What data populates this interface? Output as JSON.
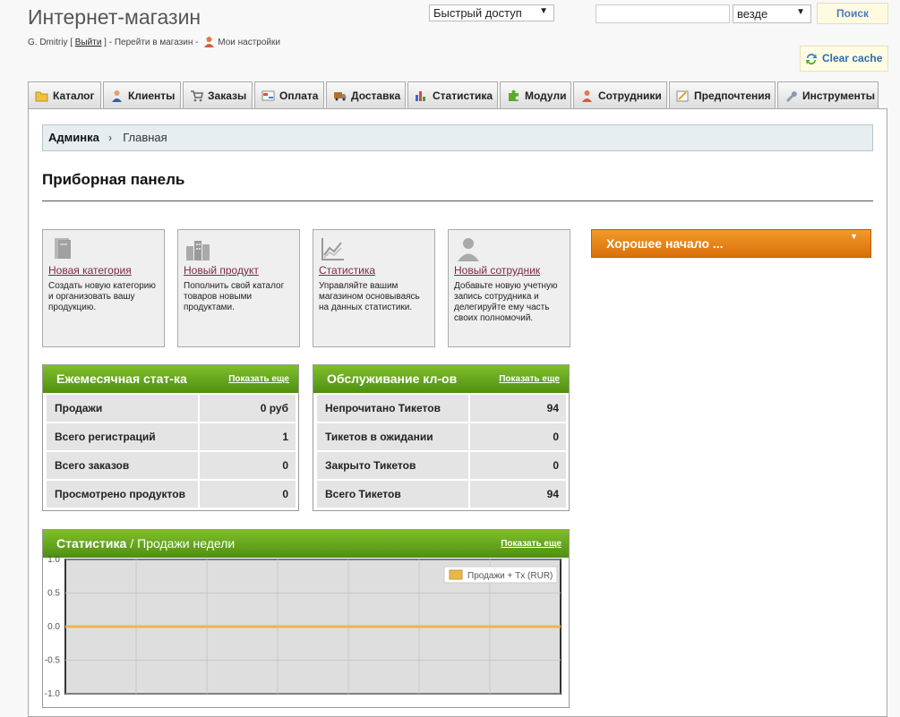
{
  "header": {
    "shop_title": "Интернет-магазин",
    "user_name": "G. Dmitriy",
    "logout_label": "Выйти",
    "goto_shop": "Перейти в магазин",
    "my_settings": "Мои настройки",
    "quick_access": "Быстрый доступ",
    "search_placeholder": "",
    "search_scope": "везде",
    "search_button": "Поиск",
    "clear_cache": "Clear cache"
  },
  "tabs": [
    {
      "label": "Каталог",
      "icon": "folder-icon"
    },
    {
      "label": "Клиенты",
      "icon": "person-icon"
    },
    {
      "label": "Заказы",
      "icon": "cart-icon"
    },
    {
      "label": "Оплата",
      "icon": "payment-icon"
    },
    {
      "label": "Доставка",
      "icon": "truck-icon"
    },
    {
      "label": "Статистика",
      "icon": "bar-chart-icon"
    },
    {
      "label": "Модули",
      "icon": "puzzle-icon"
    },
    {
      "label": "Сотрудники",
      "icon": "employee-icon"
    },
    {
      "label": "Предпочтения",
      "icon": "preferences-icon"
    },
    {
      "label": "Инструменты",
      "icon": "wrench-icon"
    }
  ],
  "breadcrumb": {
    "root": "Админка",
    "current": "Главная"
  },
  "page_title": "Приборная панель",
  "quick_cards": [
    {
      "title": "Новая категория",
      "desc": "Создать новую категорию и организовать вашу продукцию.",
      "icon": "book-icon"
    },
    {
      "title": "Новый продукт",
      "desc": "Пополнить свой каталог товаров новыми продуктами.",
      "icon": "buildings-icon"
    },
    {
      "title": "Статистика",
      "desc": "Управляйте вашим магазином основываясь на данных статистики.",
      "icon": "line-chart-icon"
    },
    {
      "title": "Новый сотрудник",
      "desc": "Добавьте новую учетную запись сотрудника и делегируйте ему часть своих полномочий.",
      "icon": "user-silhouette-icon"
    }
  ],
  "good_start": "Хорошее начало ...",
  "monthly_stats": {
    "title": "Ежемесячная стат-ка",
    "more": "Показать еще",
    "rows": [
      {
        "label": "Продажи",
        "value": "0 руб"
      },
      {
        "label": "Всего регистраций",
        "value": "1"
      },
      {
        "label": "Всего заказов",
        "value": "0"
      },
      {
        "label": "Просмотрено продуктов",
        "value": "0"
      }
    ]
  },
  "customer_service": {
    "title": "Обслуживание кл-ов",
    "more": "Показать еще",
    "rows": [
      {
        "label": "Непрочитано Тикетов",
        "value": "94"
      },
      {
        "label": "Тикетов в ожидании",
        "value": "0"
      },
      {
        "label": "Закрыто Тикетов",
        "value": "0"
      },
      {
        "label": "Всего Тикетов",
        "value": "94"
      }
    ]
  },
  "chart_section": {
    "title": "Статистика",
    "separator": "/",
    "subtitle": "Продажи недели",
    "more": "Показать еще"
  },
  "chart_data": {
    "type": "line",
    "title": "",
    "xlabel": "",
    "ylabel": "",
    "ylim": [
      -1.0,
      1.0
    ],
    "yticks": [
      "1.0",
      "0.5",
      "0.0",
      "-0.5",
      "-1.0"
    ],
    "series": [
      {
        "name": "Продажи + Tx (RUR)",
        "color": "#e8b84a",
        "values": [
          0,
          0,
          0,
          0,
          0,
          0,
          0
        ]
      }
    ],
    "legend": "top-right",
    "grid": true
  }
}
